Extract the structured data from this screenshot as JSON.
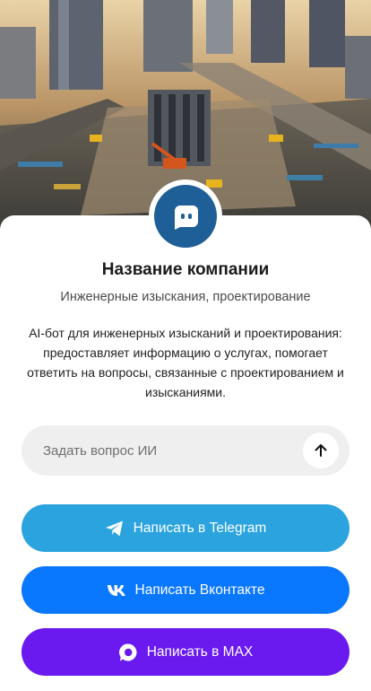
{
  "company": {
    "name": "Название компании",
    "tagline": "Инженерные изыскания, проектирование",
    "description": "AI-бот для инженерных изысканий и проектирования: предоставляет информацию о услугах, помогает ответить на вопросы, связанные с проектированием и изысканиями."
  },
  "ask": {
    "placeholder": "Задать вопрос ИИ",
    "send_icon": "arrow-up-icon"
  },
  "buttons": [
    {
      "label": "Написать в Telegram",
      "icon": "telegram-icon",
      "color": "#2aa3df"
    },
    {
      "label": "Написать Вконтакте",
      "icon": "vk-icon",
      "color": "#0a77ff"
    },
    {
      "label": "Написать в MAX",
      "icon": "max-icon",
      "color": "#6a19ef"
    }
  ],
  "colors": {
    "avatar_bg": "#1f5f97",
    "input_bg": "#efefef"
  }
}
